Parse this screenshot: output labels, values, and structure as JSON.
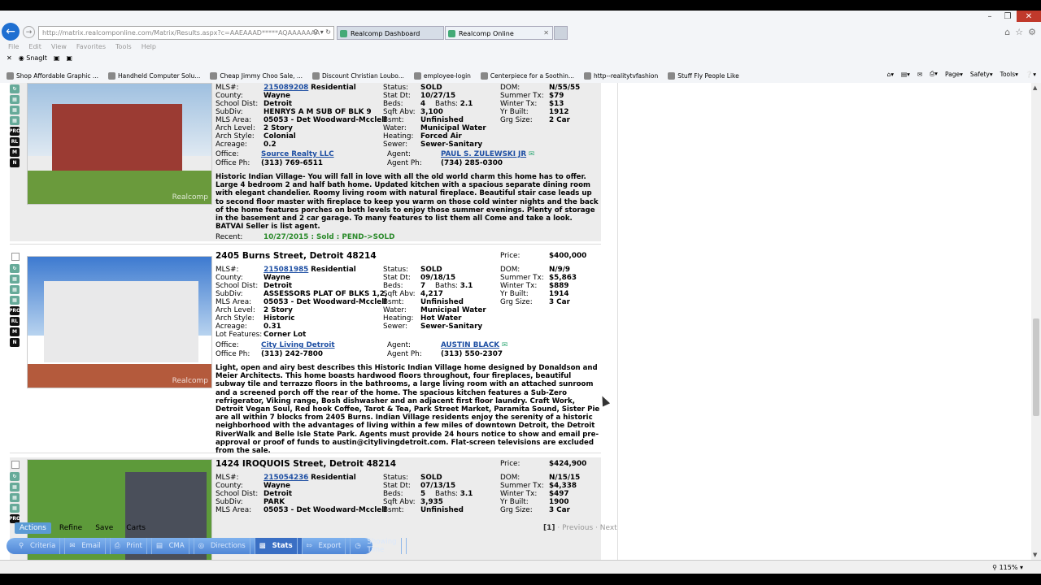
{
  "browser": {
    "address": "http://matrix.realcomponline.com/Matrix/Results.aspx?c=AAEAAAD*****AQAAAAAAA",
    "address_host": "realcomponline.com",
    "tabs": [
      {
        "label": "Realcomp Dashboard"
      },
      {
        "label": "Realcomp Online"
      }
    ],
    "menu": [
      "File",
      "Edit",
      "View",
      "Favorites",
      "Tools",
      "Help"
    ],
    "snagit": "SnagIt",
    "favorites": [
      "Shop Affordable Graphic ...",
      "Handheld Computer Solu...",
      "Cheap Jimmy Choo Sale, ...",
      "Discount Christian Loubo...",
      "employee-login",
      "Centerpiece for a Soothin...",
      "http--realitytvfashion",
      "Stuff Fly People Like"
    ],
    "commands": [
      "Page",
      "Safety",
      "Tools"
    ],
    "zoom": "115%"
  },
  "listings": [
    {
      "address": "",
      "price_label": "",
      "price": "",
      "mls_label": "MLS#:",
      "mls": "215089208",
      "type": "Residential",
      "fields_left": [
        {
          "label": "County:",
          "value": "Wayne"
        },
        {
          "label": "School Dist:",
          "value": "Detroit"
        },
        {
          "label": "SubDiv:",
          "value": "HENRYS A M SUB OF BLK 9"
        },
        {
          "label": "MLS Area:",
          "value": "05053 - Det Woodward-Mcclell"
        },
        {
          "label": "Arch Level:",
          "value": "2 Story"
        },
        {
          "label": "Arch Style:",
          "value": "Colonial"
        },
        {
          "label": "Acreage:",
          "value": "0.2"
        }
      ],
      "status": "SOLD",
      "stat_dt": "10/27/15",
      "beds": "4",
      "baths": "2.1",
      "sqft": "3,100",
      "bsmt": "Unfinished",
      "water": "Municipal Water",
      "heating": "Forced Air",
      "sewer": "Sewer-Sanitary",
      "dom": "N/55/55",
      "summer_tx": "$79",
      "winter_tx": "$13",
      "yr_built": "1912",
      "grg": "2 Car",
      "office": "Source Realty LLC",
      "office_ph": "(313) 769-6511",
      "agent": "PAUL S. ZULEWSKI JR",
      "agent_ph": "(734) 285-0300",
      "description": "Historic Indian Village- You will fall in love with all the old world charm this home has to offer. Large 4 bedroom 2 and half bath home. Updated kitchen with a spacious separate dining room with elegant chandelier. Roomy living room with natural fireplace. Beautiful stair case leads up to second floor master with fireplace to keep you warm on those cold winter nights and the back of the home features porches on both levels to enjoy those summer evenings. Plenty of storage in the basement and 2 car garage. To many features to list them all Come and take a look. BATVAI Seller is list agent.",
      "recent_label": "Recent:",
      "recent": "10/27/2015 : Sold : PEND->SOLD"
    },
    {
      "address": "2405 Burns Street, Detroit 48214",
      "price_label": "Price:",
      "price": "$400,000",
      "mls_label": "MLS#:",
      "mls": "215081985",
      "type": "Residential",
      "fields_left": [
        {
          "label": "County:",
          "value": "Wayne"
        },
        {
          "label": "School Dist:",
          "value": "Detroit"
        },
        {
          "label": "SubDiv:",
          "value": "ASSESSORS PLAT OF BLKS 1,2,"
        },
        {
          "label": "MLS Area:",
          "value": "05053 - Det Woodward-Mcclell"
        },
        {
          "label": "Arch Level:",
          "value": "2 Story"
        },
        {
          "label": "Arch Style:",
          "value": "Historic"
        },
        {
          "label": "Acreage:",
          "value": "0.31"
        },
        {
          "label": "Lot Features:",
          "value": "Corner Lot"
        }
      ],
      "status": "SOLD",
      "stat_dt": "09/18/15",
      "beds": "7",
      "baths": "3.1",
      "sqft": "4,217",
      "bsmt": "Unfinished",
      "water": "Municipal Water",
      "heating": "Hot Water",
      "sewer": "Sewer-Sanitary",
      "dom": "N/9/9",
      "summer_tx": "$5,863",
      "winter_tx": "$889",
      "yr_built": "1914",
      "grg": "3 Car",
      "office": "City Living Detroit",
      "office_ph": "(313) 242-7800",
      "agent": "AUSTIN BLACK",
      "agent_ph": "(313) 550-2307",
      "description": "Light, open and airy best describes this Historic Indian Village home designed by Donaldson and Meier Architects. This home boasts hardwood floors throughout, four fireplaces, beautiful subway tile and terrazzo floors in the bathrooms, a large living room with an attached sunroom and a screened porch off the rear of the home. The spacious kitchen features a Sub-Zero refrigerator, Viking range, Bosh dishwasher and an adjacent first floor laundry. Craft Work, Detroit Vegan Soul, Red hook Coffee, Tarot & Tea, Park Street Market, Paramita Sound, Sister Pie are all within 7 blocks from 2405 Burns. Indian Village residents enjoy the serenity of a historic neighborhood with the advantages of living within a few miles of downtown Detroit, the Detroit RiverWalk and Belle Isle State Park. Agents must provide 24 hours notice to show and email pre-approval or proof of funds to austin@citylivingdetroit.com. Flat-screen televisions are excluded from the sale."
    },
    {
      "address": "1424 IROQUOIS Street, Detroit 48214",
      "price_label": "Price:",
      "price": "$424,900",
      "mls_label": "MLS#:",
      "mls": "215054236",
      "type": "Residential",
      "fields_left": [
        {
          "label": "County:",
          "value": "Wayne"
        },
        {
          "label": "School Dist:",
          "value": "Detroit"
        },
        {
          "label": "SubDiv:",
          "value": "PARK"
        },
        {
          "label": "MLS Area:",
          "value": "05053 - Det Woodward-Mcclell"
        }
      ],
      "status": "SOLD",
      "stat_dt": "07/13/15",
      "beds": "5",
      "baths": "3.1",
      "sqft": "3,935",
      "bsmt": "Unfinished",
      "dom": "N/15/15",
      "summer_tx": "$4,338",
      "winter_tx": "$497",
      "yr_built": "1900",
      "grg": "3 Car"
    }
  ],
  "labels": {
    "status": "Status:",
    "stat_dt": "Stat Dt:",
    "beds": "Beds:",
    "baths": "Baths:",
    "sqft": "Sqft Abv:",
    "bsmt": "Bsmt:",
    "water": "Water:",
    "heating": "Heating:",
    "sewer": "Sewer:",
    "dom": "DOM:",
    "summer_tx": "Summer Tx:",
    "winter_tx": "Winter Tx:",
    "yr_built": "Yr Built:",
    "grg": "Grg Size:",
    "office": "Office:",
    "office_ph": "Office Ph:",
    "agent": "Agent:",
    "agent_ph": "Agent Ph:",
    "watermark": "Realcomp"
  },
  "actions": {
    "items": [
      "Actions",
      "Refine",
      "Save",
      "Carts"
    ],
    "active": "Actions"
  },
  "pager": {
    "current": "[1]",
    "prev": "Previous",
    "next": "Next"
  },
  "toolbar": {
    "items": [
      "Criteria",
      "Email",
      "Print",
      "CMA",
      "Directions",
      "Stats",
      "Export",
      "Showing Time"
    ],
    "active": "Stats"
  },
  "side_icons": [
    "PRO",
    "RL",
    "M",
    "N"
  ]
}
